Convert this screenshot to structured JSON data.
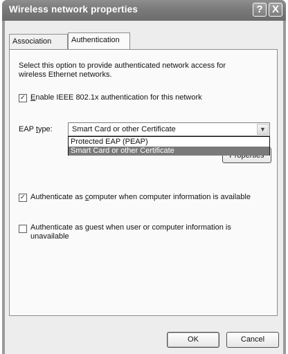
{
  "window": {
    "title": "Wireless network properties",
    "help_label": "?",
    "close_label": "X"
  },
  "tabs": [
    {
      "label": "Association",
      "active": false
    },
    {
      "label": "Authentication",
      "active": true
    }
  ],
  "auth": {
    "description": "Select this option to provide authenticated network access for wireless Ethernet networks.",
    "enable_8021x": {
      "label": "Enable IEEE 802.1x authentication for this network",
      "checked": true
    },
    "eap_type_label": "EAP type:",
    "eap_type_selected": "Smart Card or other Certificate",
    "eap_options": [
      "Protected EAP (PEAP)",
      "Smart Card or other Certificate"
    ],
    "properties_label": "Properties",
    "auth_as_computer": {
      "label": "Authenticate as computer when computer information is available",
      "checked": true
    },
    "auth_as_guest": {
      "label": "Authenticate as guest when user or computer information is unavailable",
      "checked": false
    }
  },
  "footer": {
    "ok_label": "OK",
    "cancel_label": "Cancel"
  },
  "icons": {
    "combo_arrow": "chevron-down-icon",
    "checkmark": "checkmark-icon"
  }
}
